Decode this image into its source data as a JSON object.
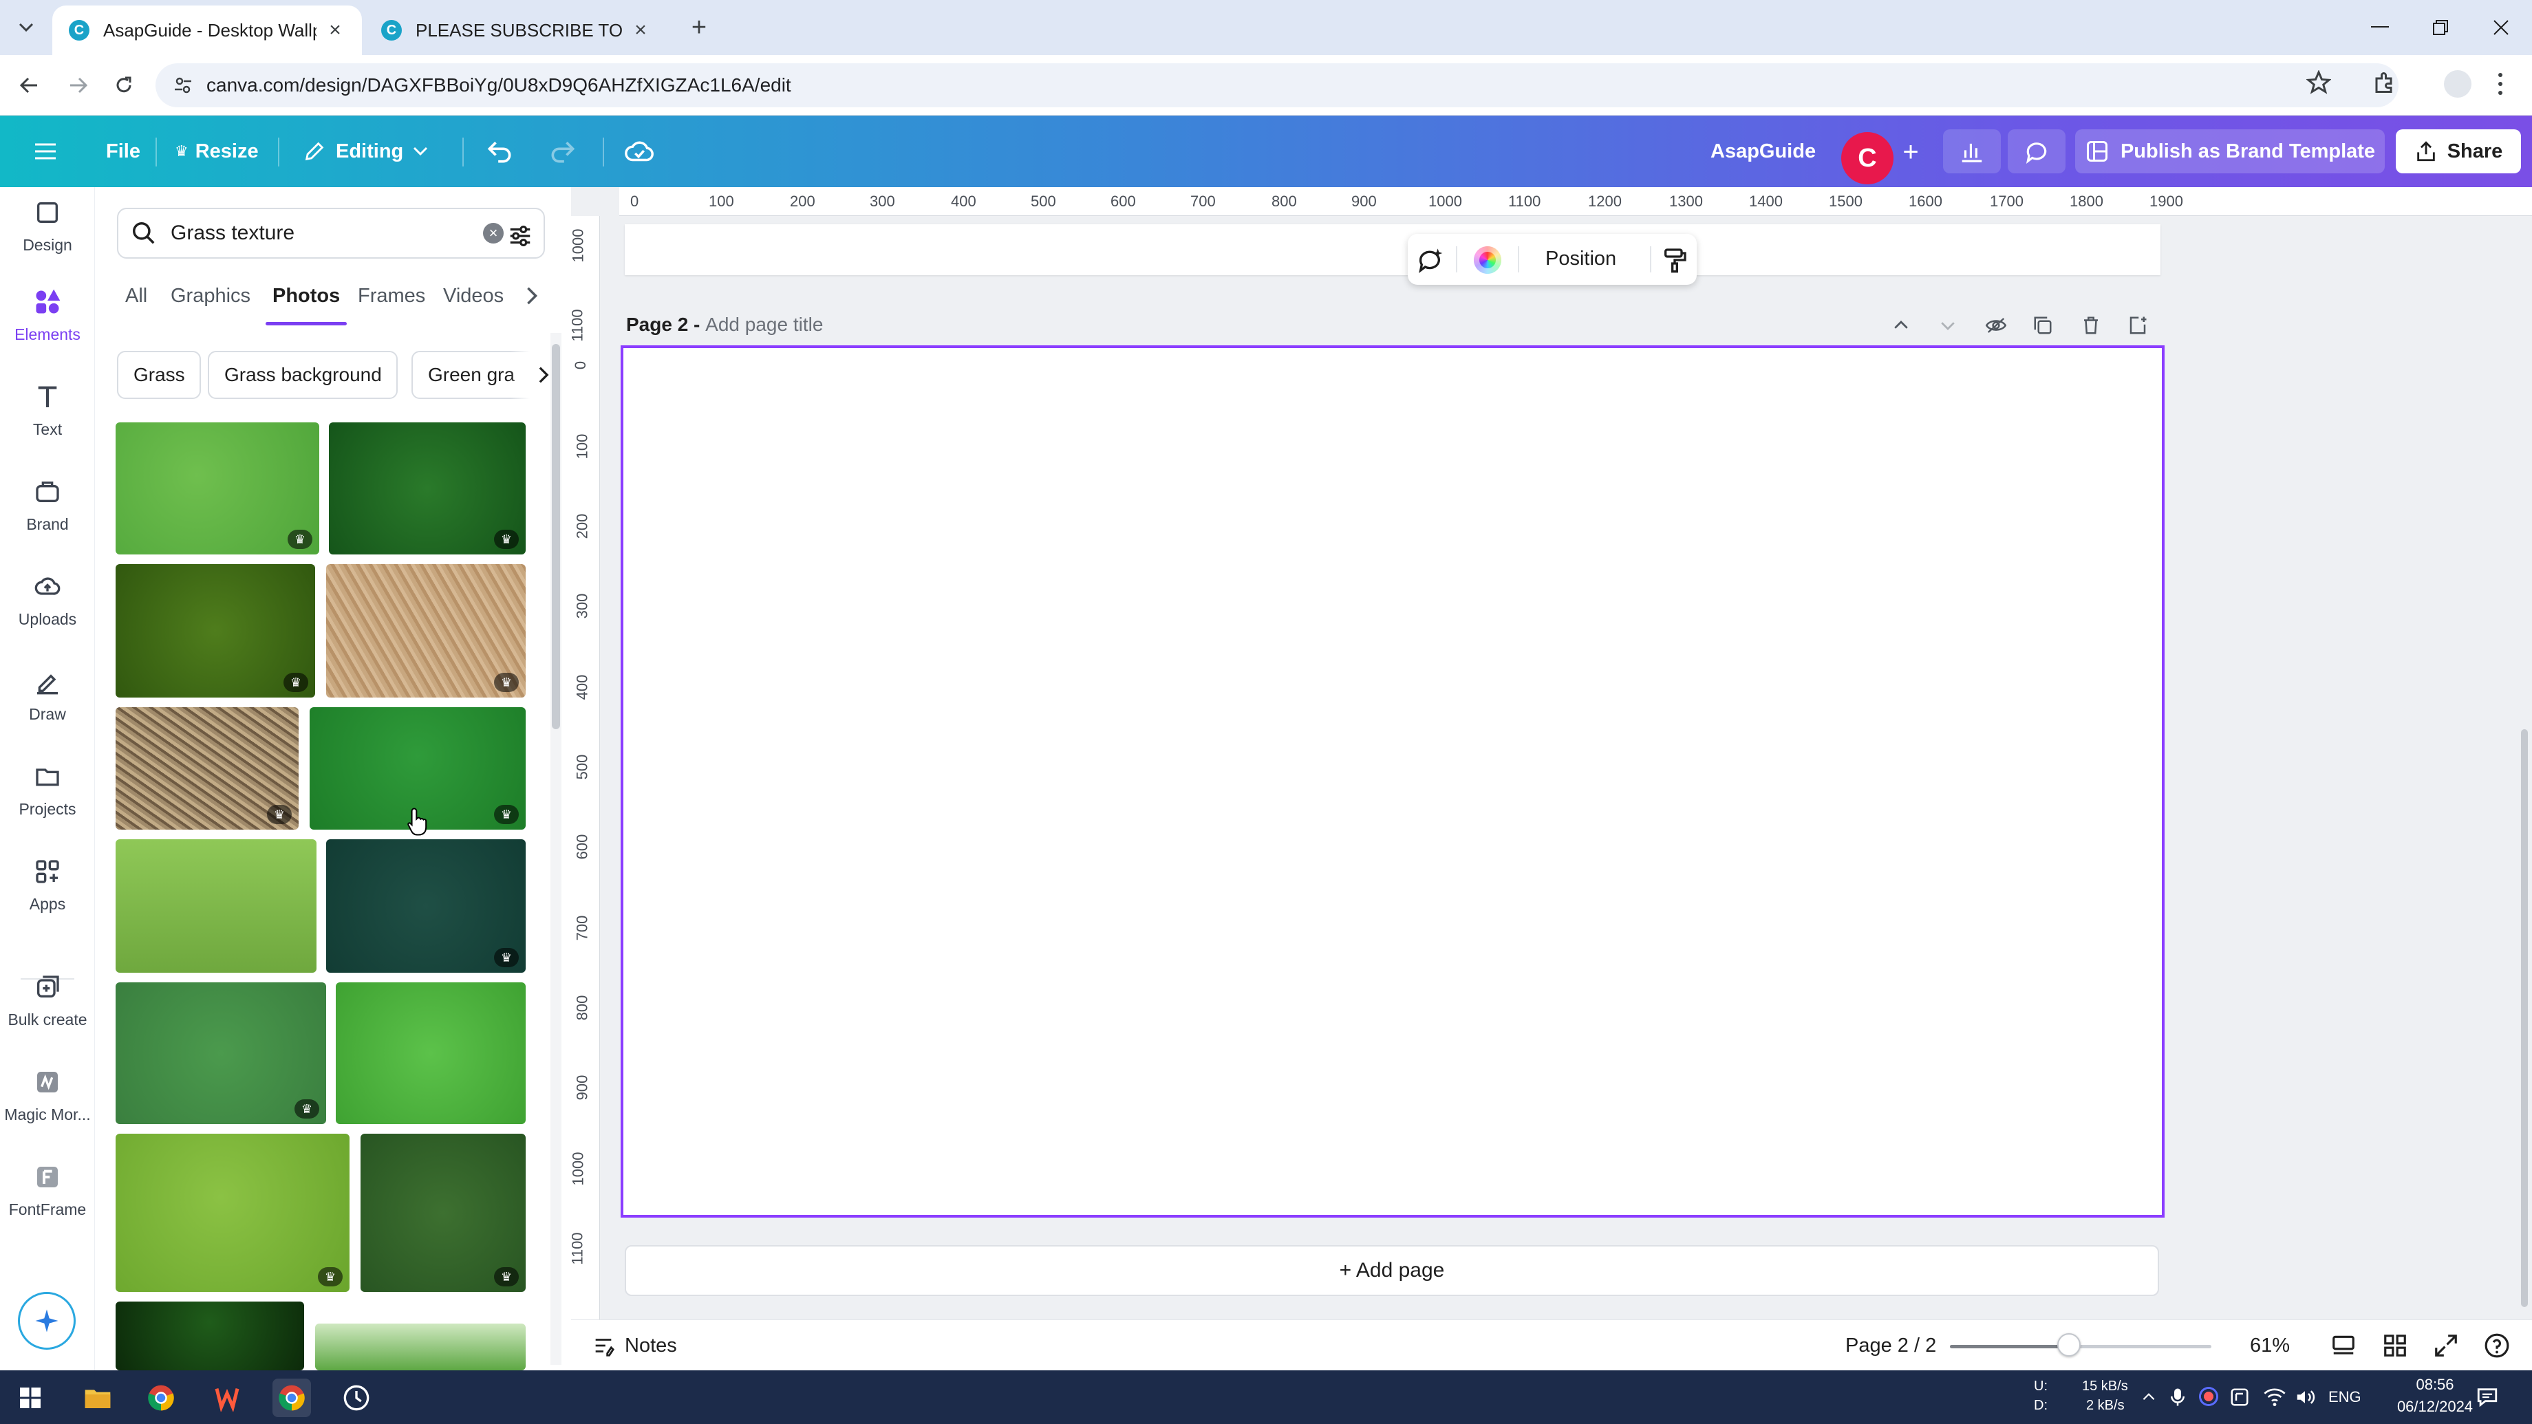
{
  "browser": {
    "tabs": [
      {
        "title": "AsapGuide - Desktop Wallpape",
        "active": true
      },
      {
        "title": "PLEASE SUBSCRIBE TO THIS CH",
        "active": false
      }
    ],
    "url": "canva.com/design/DAGXFBBoiYg/0U8xD9Q6AHZfXIGZAc1L6A/edit"
  },
  "header": {
    "file": "File",
    "resize": "Resize",
    "editing": "Editing",
    "workspace": "AsapGuide",
    "avatar_letter": "C",
    "publish": "Publish as Brand Template",
    "share": "Share"
  },
  "rail": [
    {
      "label": "Design",
      "icon": "design-icon"
    },
    {
      "label": "Elements",
      "icon": "elements-icon"
    },
    {
      "label": "Text",
      "icon": "text-icon"
    },
    {
      "label": "Brand",
      "icon": "brand-icon"
    },
    {
      "label": "Uploads",
      "icon": "uploads-icon"
    },
    {
      "label": "Draw",
      "icon": "draw-icon"
    },
    {
      "label": "Projects",
      "icon": "projects-icon"
    },
    {
      "label": "Apps",
      "icon": "apps-icon"
    },
    {
      "label": "Bulk create",
      "icon": "bulk-create-icon"
    },
    {
      "label": "Magic Mor...",
      "icon": "magic-morph-icon"
    },
    {
      "label": "FontFrame",
      "icon": "fontframe-icon"
    }
  ],
  "panel": {
    "search_value": "Grass texture",
    "tabs": [
      "All",
      "Graphics",
      "Photos",
      "Frames",
      "Videos"
    ],
    "active_tab": "Photos",
    "chips": [
      "Grass",
      "Grass background",
      "Green gra"
    ]
  },
  "canvas": {
    "ruler_h": [
      "0",
      "100",
      "200",
      "300",
      "400",
      "500",
      "600",
      "700",
      "800",
      "900",
      "1000",
      "1100",
      "1200",
      "1300",
      "1400",
      "1500",
      "1600",
      "1700",
      "1800",
      "1900"
    ],
    "ruler_v": [
      "0",
      "100",
      "200",
      "300",
      "400",
      "500",
      "600",
      "700",
      "800",
      "900",
      "1000",
      "1100"
    ],
    "ruler_v_top": [
      "1000",
      "1100"
    ],
    "toolbar_position": "Position",
    "page_label": "Page 2 -",
    "page_title_placeholder": "Add page title",
    "add_page": "+ Add page"
  },
  "footer": {
    "notes": "Notes",
    "page_indicator": "Page 2 / 2",
    "zoom": "61%"
  },
  "taskbar": {
    "net_up_label": "U:",
    "net_down_label": "D:",
    "net_up": "15 kB/s",
    "net_down": "2 kB/s",
    "lang": "ENG",
    "time": "08:56",
    "date": "06/12/2024"
  }
}
